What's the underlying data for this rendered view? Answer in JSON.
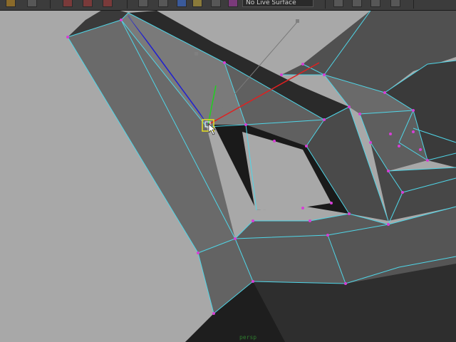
{
  "toolbar": {
    "buttons": [
      "folder-open-icon",
      "save-icon",
      "select-red-icon",
      "select-add-icon",
      "select-remove-icon",
      "grid-icon",
      "snap-icon",
      "sphere-icon",
      "mesh-icon",
      "pin-icon"
    ],
    "selection_dropdown_value": "No Live Surface",
    "right_buttons": [
      "render-icon",
      "render-frame-icon",
      "camera-icon",
      "settings-icon"
    ]
  },
  "viewport": {
    "background_color": "#a8a8a8",
    "mesh_face_color": "#5a5a5a",
    "mesh_edge_color": "#4fd6e8",
    "vertex_color": "#d63fd6",
    "manipulator": {
      "x_axis_color": "#e02020",
      "y_axis_color": "#20d020",
      "z_axis_color": "#2020d0",
      "selected_handle_color": "#e8e020"
    },
    "status_text": "persp"
  }
}
